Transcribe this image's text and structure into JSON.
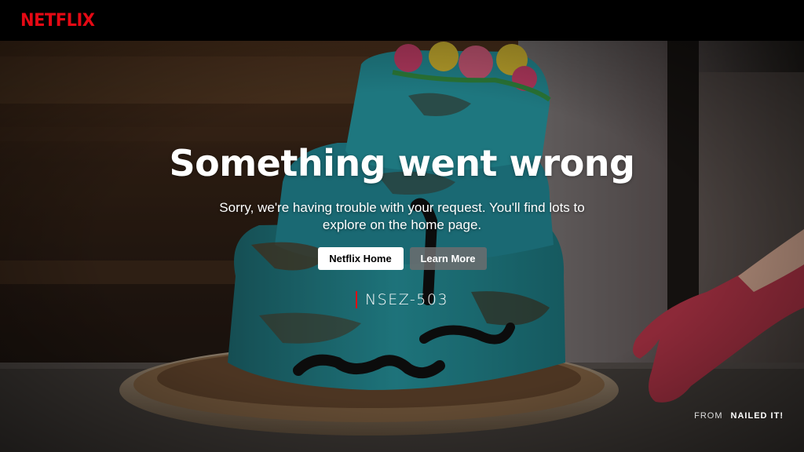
{
  "header": {
    "logo_text": "NETFLIX",
    "logo_color": "#e50914"
  },
  "error": {
    "title": "Something went wrong",
    "message": "Sorry, we're having trouble with your request. You'll find lots to explore on the home page.",
    "code": "NSEZ-503",
    "code_accent_color": "#e50914"
  },
  "actions": {
    "primary_label": "Netflix Home",
    "secondary_label": "Learn More"
  },
  "credit": {
    "prefix": "FROM",
    "show": "NAILED IT!"
  }
}
